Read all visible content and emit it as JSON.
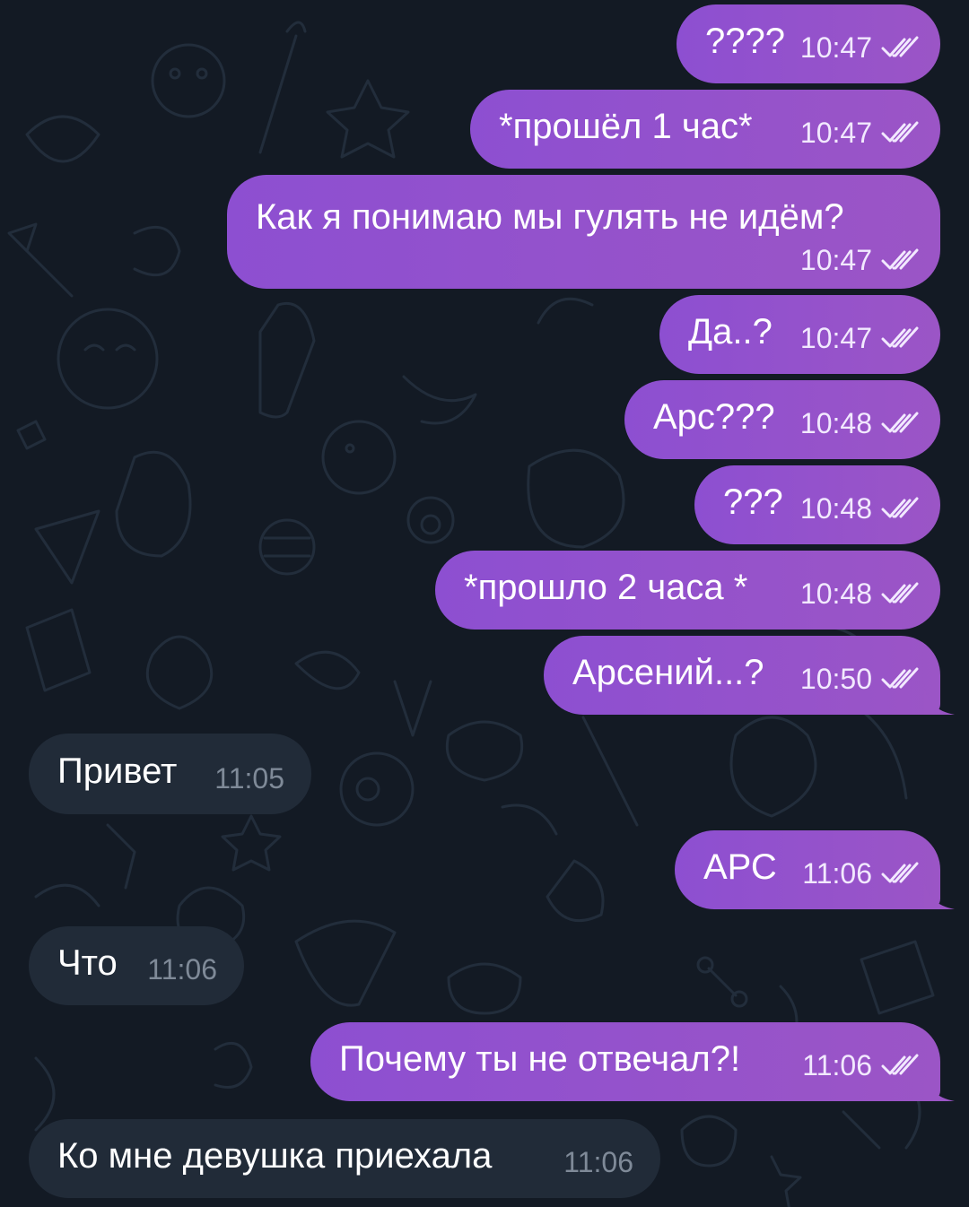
{
  "messages": [
    {
      "dir": "out",
      "text": "????",
      "time": "10:47",
      "read_icon": "double-check-icon"
    },
    {
      "dir": "out",
      "text": "*прошёл 1 час*",
      "time": "10:47",
      "read_icon": "double-check-icon"
    },
    {
      "dir": "out",
      "text": "Как я понимаю мы гулять не идём?",
      "time": "10:47",
      "read_icon": "double-check-icon"
    },
    {
      "dir": "out",
      "text": "Да..?",
      "time": "10:47",
      "read_icon": "double-check-icon"
    },
    {
      "dir": "out",
      "text": "Арс???",
      "time": "10:48",
      "read_icon": "double-check-icon"
    },
    {
      "dir": "out",
      "text": "???",
      "time": "10:48",
      "read_icon": "double-check-icon"
    },
    {
      "dir": "out",
      "text": "*прошло 2 часа *",
      "time": "10:48",
      "read_icon": "double-check-icon"
    },
    {
      "dir": "out",
      "text": "Арсений...?",
      "time": "10:50",
      "read_icon": "double-check-icon"
    },
    {
      "dir": "in",
      "text": "Привет",
      "time": "11:05"
    },
    {
      "dir": "out",
      "text": "АРС",
      "time": "11:06",
      "read_icon": "double-check-icon"
    },
    {
      "dir": "in",
      "text": "Что",
      "time": "11:06"
    },
    {
      "dir": "out",
      "text": "Почему ты не отвечал?!",
      "time": "11:06",
      "read_icon": "double-check-icon"
    },
    {
      "dir": "in",
      "text": "Ко мне девушка приехала",
      "time": "11:06"
    }
  ],
  "colors": {
    "background": "#131a24",
    "outgoing_bubble": "#9452cc",
    "incoming_bubble": "#212b38",
    "incoming_time": "#7f8a98"
  }
}
